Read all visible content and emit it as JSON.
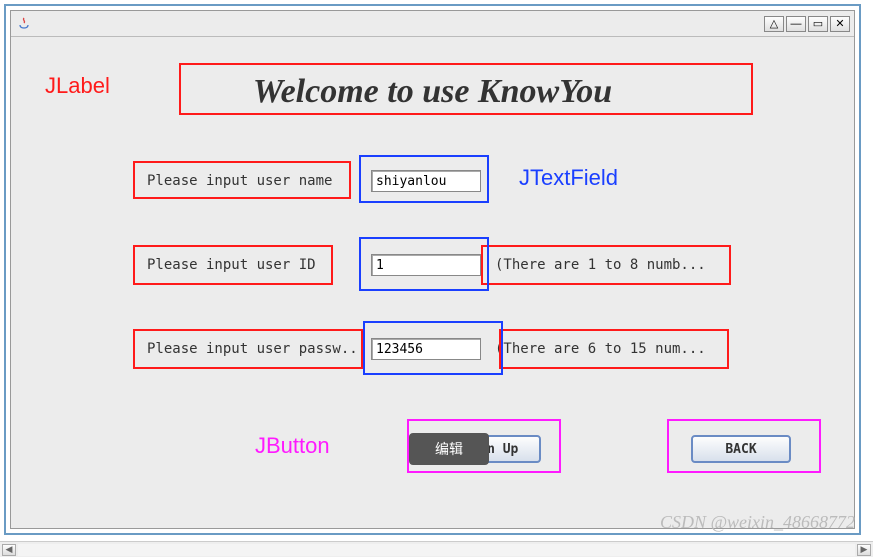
{
  "titlebar": {
    "min_symbol": "△",
    "minimize_symbol": "—",
    "restore_symbol": "▭",
    "close_symbol": "✕"
  },
  "heading": {
    "welcome": "Welcome to use KnowYou"
  },
  "fields": {
    "username_label": "Please input user name",
    "username_value": "shiyanlou",
    "userid_label": "Please input user ID",
    "userid_value": "1",
    "userid_hint": "(There are 1 to 8 numb...",
    "password_label": "Please input user passw...",
    "password_value": "123456",
    "password_hint": "(There are 6 to 15 num..."
  },
  "buttons": {
    "signup": "Sign Up",
    "back": "BACK"
  },
  "overlay": {
    "edit": "编辑"
  },
  "annotations": {
    "jlabel": "JLabel",
    "jtextfield": "JTextField",
    "jbutton": "JButton"
  },
  "watermark": "CSDN @weixin_48668772",
  "scroll": {
    "left": "◀",
    "right": "▶"
  }
}
